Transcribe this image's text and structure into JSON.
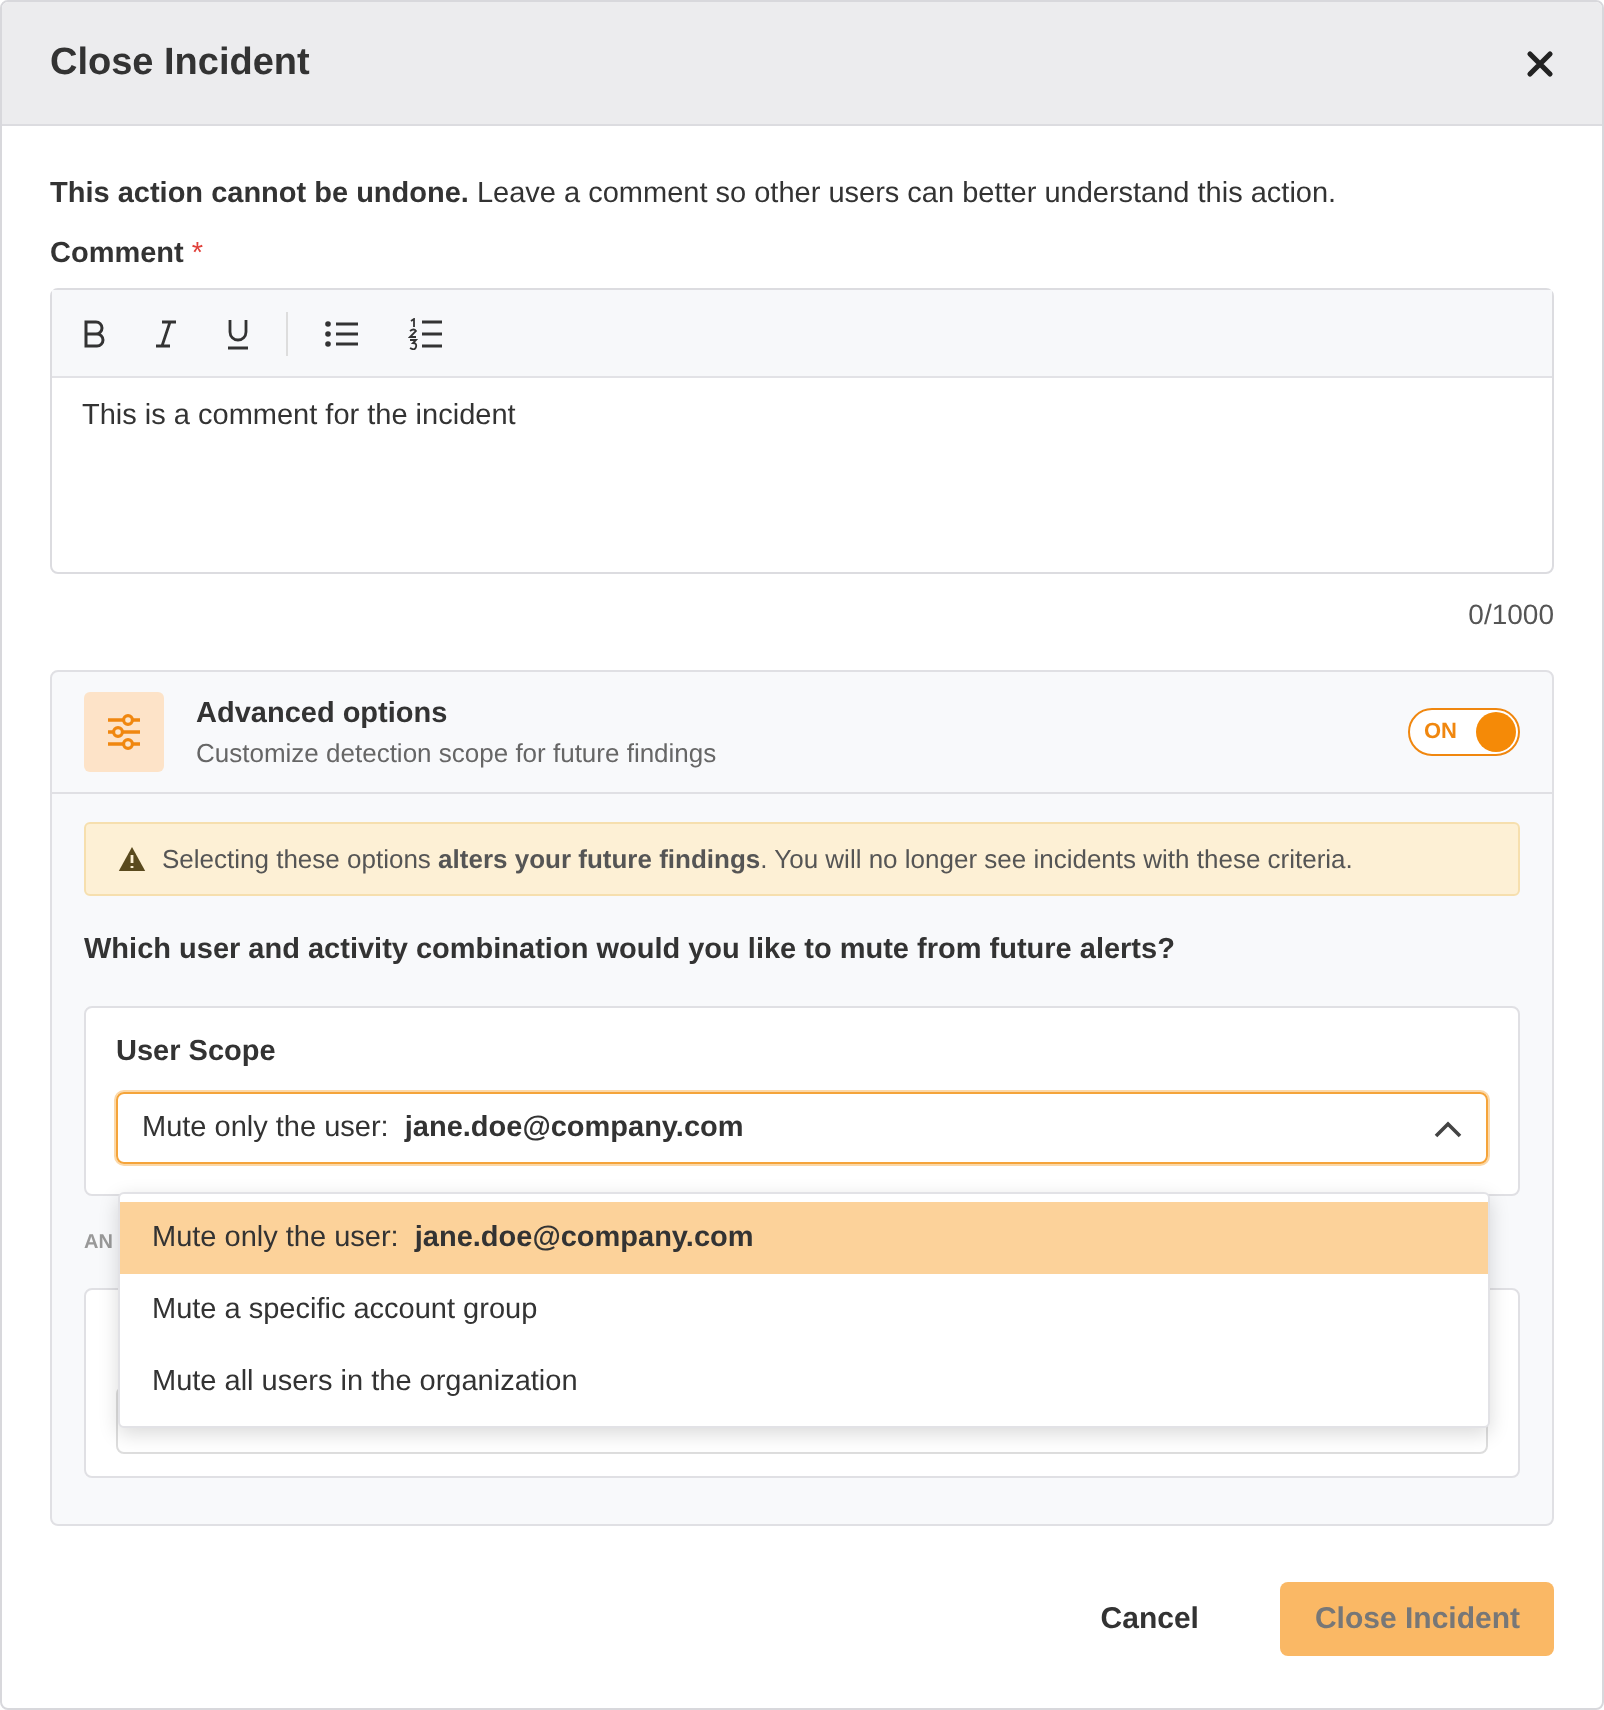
{
  "window": {
    "title": "Close Incident"
  },
  "intro": "**This action cannot be undone.** Leave a comment so other users can better understand this action.",
  "comment": {
    "label": "Comment",
    "required_mark": "*",
    "value": "This is a comment for the incident",
    "counter": "0/1000"
  },
  "advanced": {
    "title": "Advanced options",
    "subtitle": "Customize detection scope for future findings",
    "toggle": {
      "label": "ON",
      "on": true
    },
    "warning": "Selecting these options **alters your future findings**. You will no longer see incidents with these criteria.",
    "question": "Which user and activity combination would you like to mute from future alerts?",
    "user_scope": {
      "label": "User Scope",
      "value": "Mute only the user:  **jane.doe@company.com**",
      "expanded": true,
      "options": [
        {
          "label": "Mute only the user:  **jane.doe@company.com**",
          "selected": true
        },
        {
          "label": "Mute a specific account group",
          "selected": false
        },
        {
          "label": "Mute all users in the organization",
          "selected": false
        }
      ]
    },
    "connector": "AN"
  },
  "buttons": [
    {
      "label": "Cancel",
      "kind": "text"
    },
    {
      "label": "Close Incident",
      "kind": "primary",
      "disabled": true
    }
  ]
}
